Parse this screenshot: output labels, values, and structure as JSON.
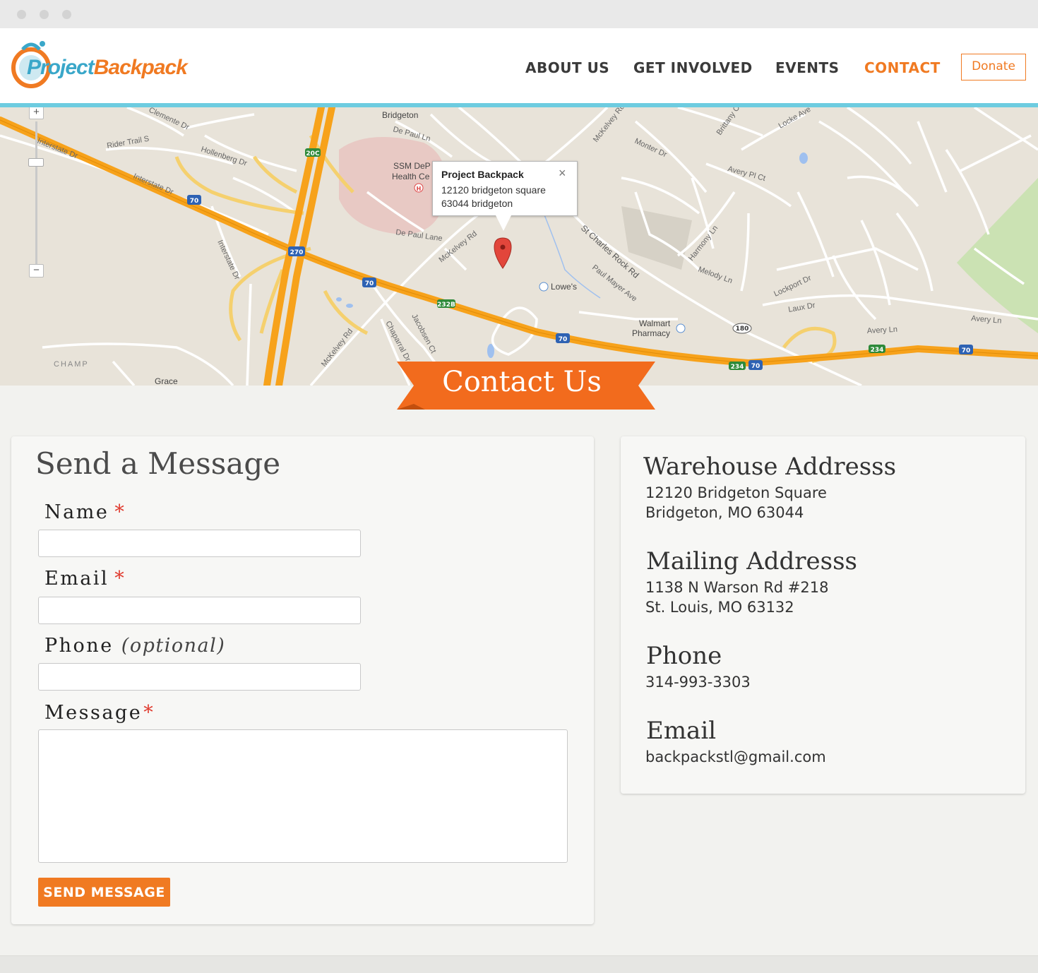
{
  "nav": {
    "logo_part1": "Project",
    "logo_part2": "Backpack",
    "items": [
      {
        "label": "ABOUT US",
        "active": false
      },
      {
        "label": "GET INVOLVED",
        "active": false
      },
      {
        "label": "EVENTS",
        "active": false
      },
      {
        "label": "CONTACT",
        "active": true
      }
    ],
    "donate_label": "Donate"
  },
  "map": {
    "zoom_in": "+",
    "zoom_out": "−",
    "infowindow": {
      "title": "Project Backpack",
      "line1": "12120 bridgeton square",
      "line2": "63044 bridgeton",
      "close": "×"
    },
    "labels": {
      "interstate_dr": "Interstate Dr",
      "rider_trail": "Rider Trail S",
      "hollenberg": "Hollenberg Dr",
      "clemente": "Clemente Dr",
      "bridgeton": "Bridgeton",
      "de_paul_ln": "De Paul Ln",
      "ssm": "SSM DeP",
      "health": "Health Ce",
      "de_paul_lane": "De Paul Lane",
      "mckelvey": "McKelvey Rd",
      "lowes": "Lowe's",
      "st_charles": "St Charles Rock Rd",
      "paul_mayer": "Paul Mayer Ave",
      "walmart": "Walmart",
      "pharmacy": "Pharmacy",
      "avery_pl": "Avery Pl Ct",
      "avery_ln": "Avery Ln",
      "lockport": "Lockport Dr",
      "laux": "Laux Dr",
      "melody": "Melody Ln",
      "harmony": "Harmony Ln",
      "champ": "CHAMP",
      "grace": "Grace",
      "chaparral": "Chaparral Dr",
      "jacobsen": "Jacobsen Ct",
      "interstate_dr2": "Interstate Dr",
      "monter": "Monter Dr",
      "locke": "Locke Ave",
      "brittany": "Brittany Ct"
    },
    "shields": {
      "i70": "70",
      "i270": "270",
      "r232b": "232B",
      "r20c": "20C",
      "r180": "180",
      "r234": "234"
    }
  },
  "banner": {
    "title": "Contact Us"
  },
  "form": {
    "heading": "Send a Message",
    "name_label": "Name",
    "email_label": "Email",
    "phone_label": "Phone",
    "phone_optional": "(optional)",
    "message_label": "Message",
    "required_mark": "*",
    "submit_label": "SEND MESSAGE"
  },
  "info": {
    "warehouse_heading": "Warehouse Addresss",
    "warehouse_line1": "12120 Bridgeton Square",
    "warehouse_line2": "Bridgeton, MO 63044",
    "mailing_heading": "Mailing Addresss",
    "mailing_line1": "1138 N Warson Rd #218",
    "mailing_line2": "St. Louis, MO 63132",
    "phone_heading": "Phone",
    "phone_value": "314-993-3303",
    "email_heading": "Email",
    "email_value": "backpackstl@gmail.com"
  },
  "colors": {
    "accent": "#f07a22",
    "header_rule": "#6dcce0",
    "required": "#e03a2e"
  }
}
